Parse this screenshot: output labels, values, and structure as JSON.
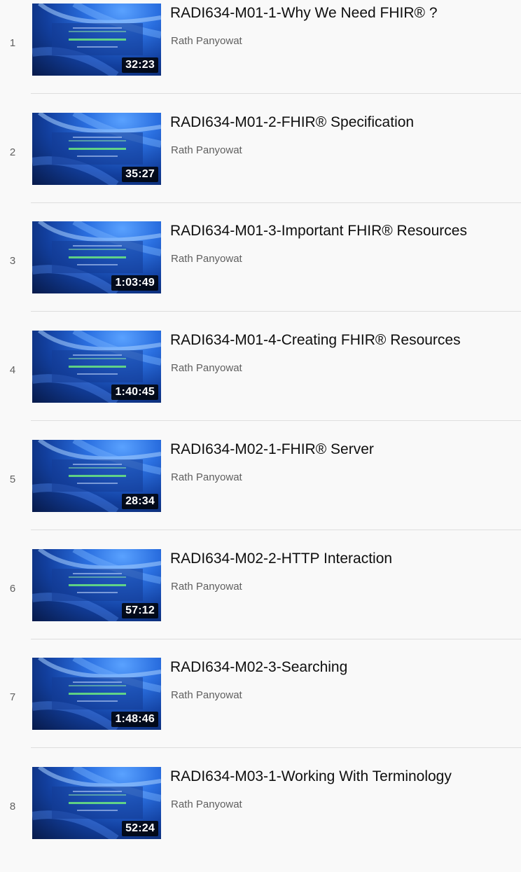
{
  "playlist": {
    "items": [
      {
        "index": "1",
        "title": "RADI634-M01-1-Why We Need FHIR® ?",
        "channel": "Rath Panyowat",
        "duration": "32:23"
      },
      {
        "index": "2",
        "title": "RADI634-M01-2-FHIR® Specification",
        "channel": "Rath Panyowat",
        "duration": "35:27"
      },
      {
        "index": "3",
        "title": "RADI634-M01-3-Important FHIR® Resources",
        "channel": "Rath Panyowat",
        "duration": "1:03:49"
      },
      {
        "index": "4",
        "title": "RADI634-M01-4-Creating FHIR® Resources",
        "channel": "Rath Panyowat",
        "duration": "1:40:45"
      },
      {
        "index": "5",
        "title": "RADI634-M02-1-FHIR® Server",
        "channel": "Rath Panyowat",
        "duration": "28:34"
      },
      {
        "index": "6",
        "title": "RADI634-M02-2-HTTP Interaction",
        "channel": "Rath Panyowat",
        "duration": "57:12"
      },
      {
        "index": "7",
        "title": "RADI634-M02-3-Searching",
        "channel": "Rath Panyowat",
        "duration": "1:48:46"
      },
      {
        "index": "8",
        "title": "RADI634-M03-1-Working With Terminology",
        "channel": "Rath Panyowat",
        "duration": "52:24"
      }
    ]
  }
}
